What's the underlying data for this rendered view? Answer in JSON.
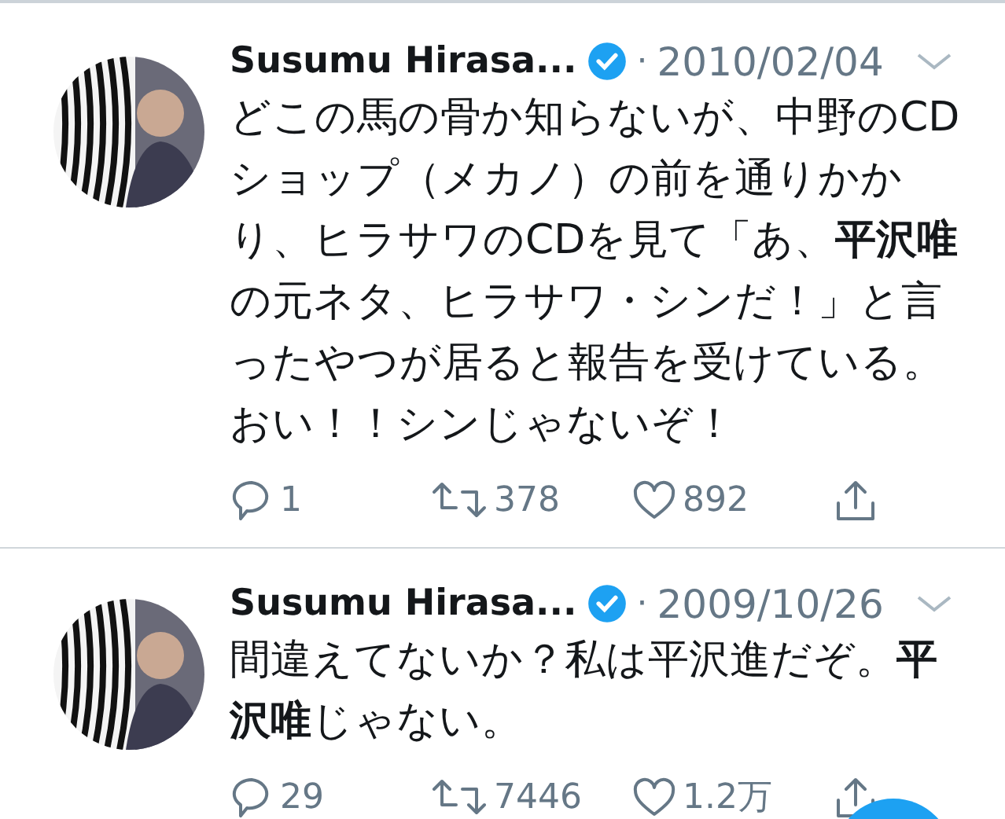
{
  "tweets": [
    {
      "author": "Susumu Hirasa...",
      "verified": true,
      "separator": "·",
      "date": "2010/02/04",
      "text": "どこの馬の骨か知らないが、中野のCDショップ（メカノ）の前を通りかかり、ヒラサワのCDを見て「あ、**平沢唯**の元ネタ、ヒラサワ・シンだ！」と言ったやつが居ると報告を受けている。おい！！シンじゃないぞ！",
      "replies": "1",
      "retweets": "378",
      "likes": "892"
    },
    {
      "author": "Susumu Hirasa...",
      "verified": true,
      "separator": "·",
      "date": "2009/10/26",
      "text": "間違えてないか？私は平沢進だぞ。**平沢唯**じゃない。",
      "replies": "29",
      "retweets": "7446",
      "likes": "1.2万"
    }
  ]
}
